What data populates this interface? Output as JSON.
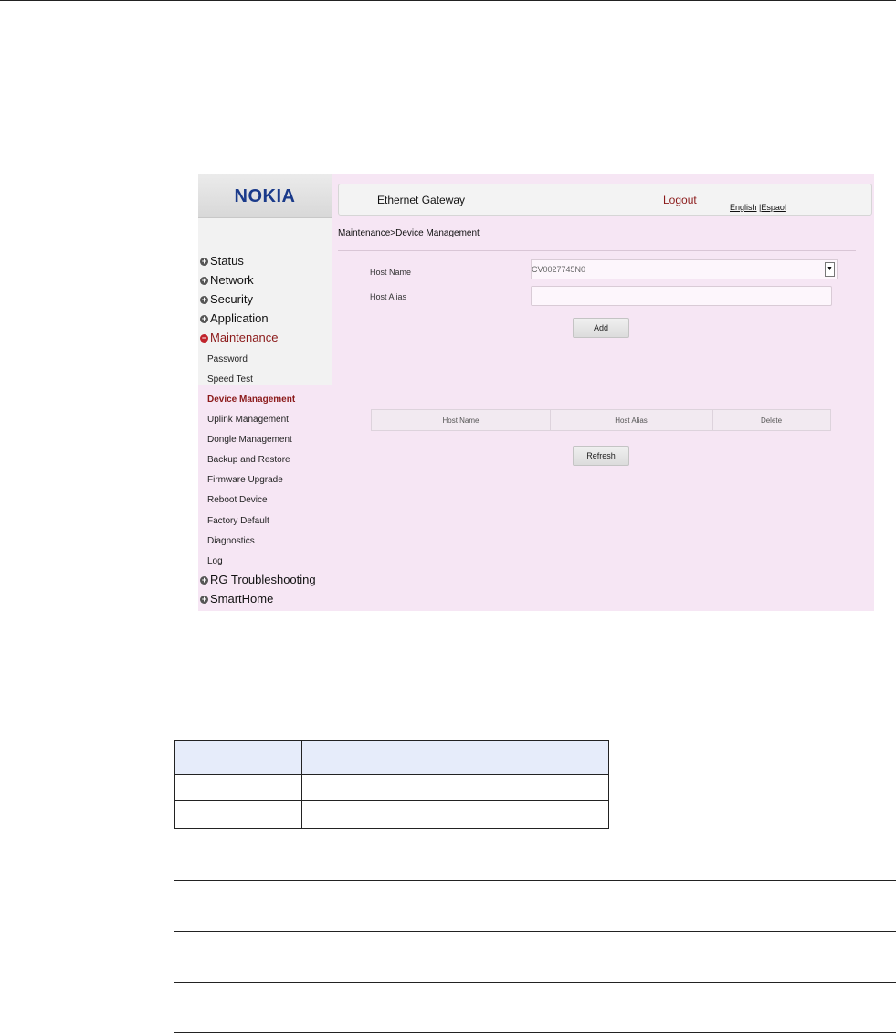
{
  "screenshot": {
    "brand": "NOKIA",
    "header": {
      "title": "Ethernet Gateway",
      "logout": "Logout",
      "lang_english": "English",
      "lang_separator": " |",
      "lang_espanol": "Espaol"
    },
    "nav": {
      "status": "Status",
      "network": "Network",
      "security": "Security",
      "application": "Application",
      "maintenance": "Maintenance",
      "sub": [
        "Password",
        "Speed Test",
        "Device Management",
        "Uplink Management",
        "Dongle Management",
        "Backup and Restore",
        "Firmware Upgrade",
        "Reboot Device",
        "Factory Default",
        "Diagnostics",
        "Log"
      ],
      "rg_troubleshooting": "RG Troubleshooting",
      "smarthome": "SmartHome"
    },
    "breadcrumb": "Maintenance>Device Management",
    "form": {
      "host_name_label": "Host Name",
      "host_name_value": "CV0027745N0",
      "host_alias_label": "Host Alias",
      "host_alias_value": "",
      "add_button": "Add",
      "refresh_button": "Refresh"
    },
    "device_table": {
      "columns": [
        "Host Name",
        "Host Alias",
        "Delete"
      ]
    }
  },
  "colors": {
    "screenshot_background": "#f6e6f4",
    "brand_blue": "#1a3a8a",
    "accent_red": "#8b1a1a",
    "table_header": "#e6ecfa"
  }
}
